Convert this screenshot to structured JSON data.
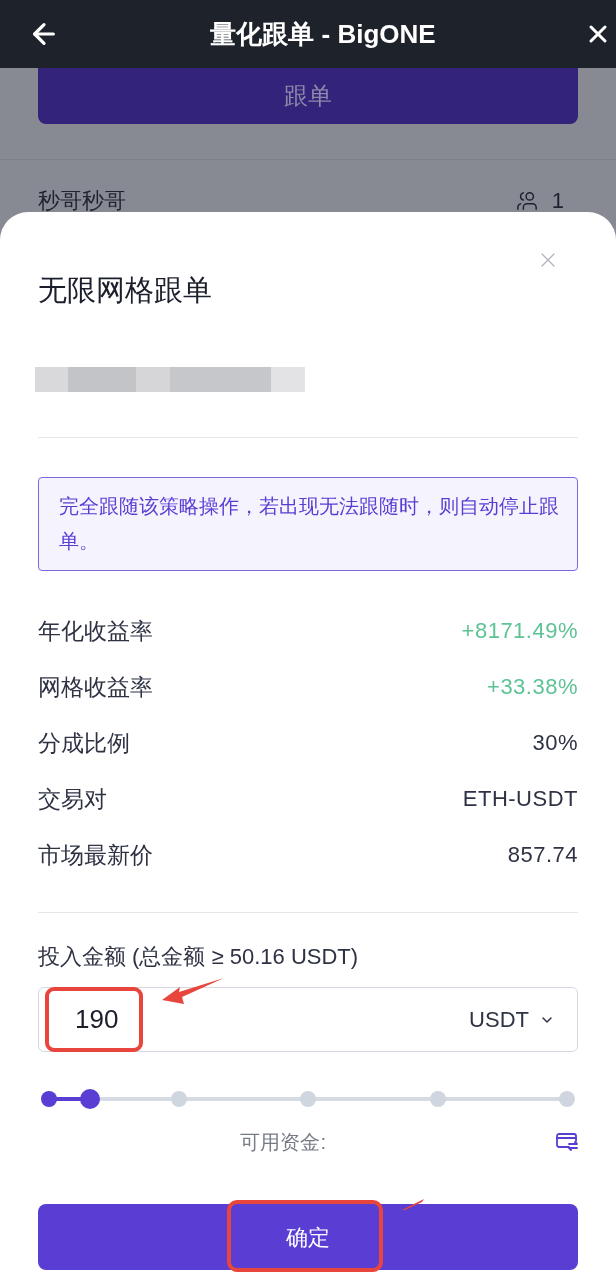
{
  "header": {
    "title": "量化跟单 - BigONE"
  },
  "background_page": {
    "follow_button": "跟单",
    "trader_name": "秒哥秒哥",
    "follower_count": "1"
  },
  "sheet": {
    "title": "无限网格跟单",
    "notice": "完全跟随该策略操作，若出现无法跟随时，则自动停止跟单。",
    "stats": [
      {
        "label": "年化收益率",
        "value": "+8171.49%",
        "kind": "gain"
      },
      {
        "label": "网格收益率",
        "value": "+33.38%",
        "kind": "gain"
      },
      {
        "label": "分成比例",
        "value": "30%",
        "kind": "plain"
      },
      {
        "label": "交易对",
        "value": "ETH-USDT",
        "kind": "plain"
      },
      {
        "label": "市场最新价",
        "value": "857.74",
        "kind": "plain"
      }
    ],
    "amount": {
      "label": "投入金额 (总金额 ≥ 50.16 USDT)",
      "value": "190",
      "currency": "USDT",
      "highlighted": true
    },
    "slider": {
      "level": 0.08
    },
    "available_funds_label": "可用资金:",
    "confirm_button": {
      "label": "确定",
      "highlighted": true
    }
  }
}
